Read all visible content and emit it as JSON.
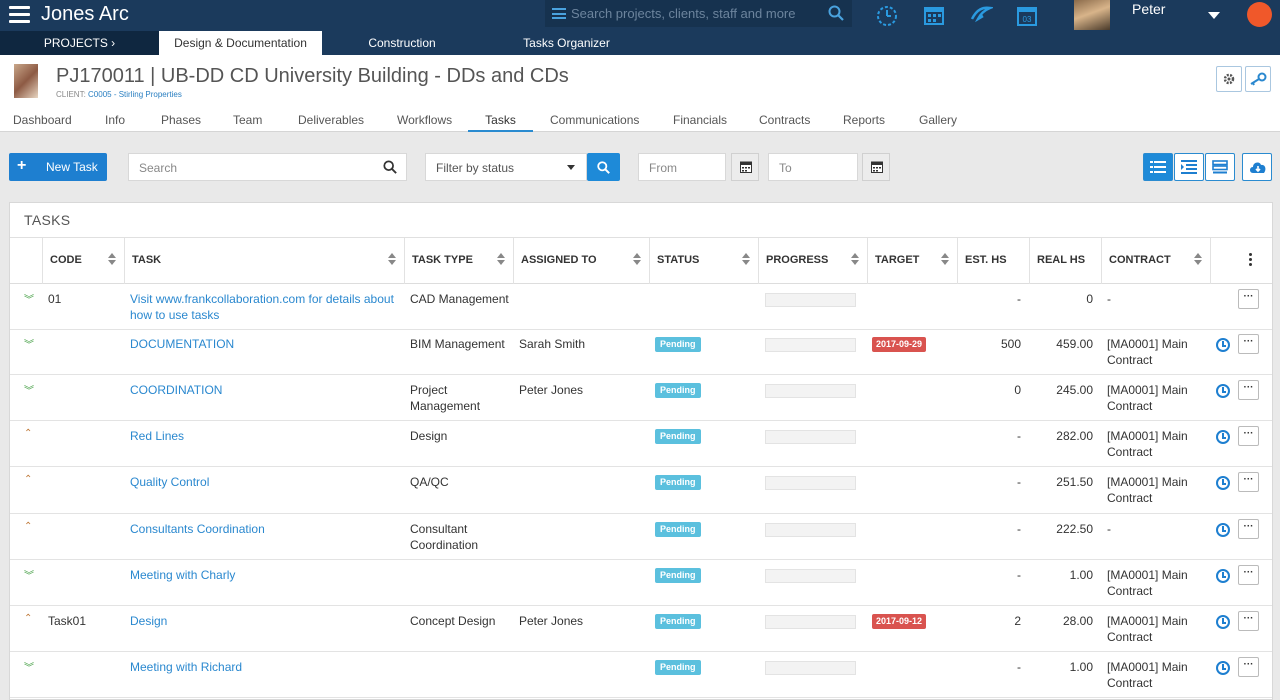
{
  "app": {
    "title": "Jones Arc",
    "search_placeholder": "Search projects, clients, staff and more",
    "user_name": "Peter"
  },
  "modules": [
    {
      "label": "PROJECTS ›",
      "active": false
    },
    {
      "label": "Design & Documentation",
      "active": true
    },
    {
      "label": "Construction",
      "active": false
    },
    {
      "label": "Tasks Organizer",
      "active": false
    }
  ],
  "project": {
    "title": "PJ170011 | UB-DD CD University Building - DDs and CDs",
    "client_label": "CLIENT:",
    "client_value": "C0005 - Stirling Properties"
  },
  "tabs": [
    "Dashboard",
    "Info",
    "Phases",
    "Team",
    "Deliverables",
    "Workflows",
    "Tasks",
    "Communications",
    "Financials",
    "Contracts",
    "Reports",
    "Gallery"
  ],
  "active_tab": "Tasks",
  "toolbar": {
    "new_task": "New Task",
    "search_placeholder": "Search",
    "filter_placeholder": "Filter by status",
    "from_placeholder": "From",
    "to_placeholder": "To"
  },
  "panel": {
    "title": "TASKS"
  },
  "columns": [
    "CODE",
    "TASK",
    "TASK TYPE",
    "ASSIGNED TO",
    "STATUS",
    "PROGRESS",
    "TARGET",
    "EST. HS",
    "REAL HS",
    "CONTRACT"
  ],
  "rows": [
    {
      "chevron": "down",
      "code": "01",
      "task_l1": "Visit www.frankcollaboration.com for details about",
      "task_l2": "how to use tasks",
      "type_l1": "CAD Management",
      "type_l2": "",
      "assigned": "",
      "status": "",
      "target": "",
      "est": "-",
      "real": "0",
      "contract_l1": "-",
      "contract_l2": "",
      "clock": false
    },
    {
      "chevron": "down",
      "code": "",
      "task_l1": "DOCUMENTATION",
      "task_l2": "",
      "type_l1": "BIM Management",
      "type_l2": "",
      "assigned": "Sarah Smith",
      "status": "Pending",
      "target": "2017-09-29",
      "est": "500",
      "real": "459.00",
      "contract_l1": "[MA0001] Main",
      "contract_l2": "Contract",
      "clock": true
    },
    {
      "chevron": "down",
      "code": "",
      "task_l1": "COORDINATION",
      "task_l2": "",
      "type_l1": "Project",
      "type_l2": "Management",
      "assigned": "Peter Jones",
      "status": "Pending",
      "target": "",
      "est": "0",
      "real": "245.00",
      "contract_l1": "[MA0001] Main",
      "contract_l2": "Contract",
      "clock": true
    },
    {
      "chevron": "up",
      "code": "",
      "task_l1": "Red Lines",
      "task_l2": "",
      "type_l1": "Design",
      "type_l2": "",
      "assigned": "",
      "status": "Pending",
      "target": "",
      "est": "-",
      "real": "282.00",
      "contract_l1": "[MA0001] Main",
      "contract_l2": "Contract",
      "clock": true
    },
    {
      "chevron": "up",
      "code": "",
      "task_l1": "Quality Control",
      "task_l2": "",
      "type_l1": "QA/QC",
      "type_l2": "",
      "assigned": "",
      "status": "Pending",
      "target": "",
      "est": "-",
      "real": "251.50",
      "contract_l1": "[MA0001] Main",
      "contract_l2": "Contract",
      "clock": true
    },
    {
      "chevron": "up",
      "code": "",
      "task_l1": "Consultants Coordination",
      "task_l2": "",
      "type_l1": "Consultant",
      "type_l2": "Coordination",
      "assigned": "",
      "status": "Pending",
      "target": "",
      "est": "-",
      "real": "222.50",
      "contract_l1": "-",
      "contract_l2": "",
      "clock": true
    },
    {
      "chevron": "down",
      "code": "",
      "task_l1": "Meeting with Charly",
      "task_l2": "",
      "type_l1": "",
      "type_l2": "",
      "assigned": "",
      "status": "Pending",
      "target": "",
      "est": "-",
      "real": "1.00",
      "contract_l1": "[MA0001] Main",
      "contract_l2": "Contract",
      "clock": true
    },
    {
      "chevron": "up",
      "code": "Task01",
      "task_l1": "Design",
      "task_l2": "",
      "type_l1": "Concept Design",
      "type_l2": "",
      "assigned": "Peter Jones",
      "status": "Pending",
      "target": "2017-09-12",
      "est": "2",
      "real": "28.00",
      "contract_l1": "[MA0001] Main",
      "contract_l2": "Contract",
      "clock": true
    },
    {
      "chevron": "down",
      "code": "",
      "task_l1": "Meeting with Richard",
      "task_l2": "",
      "type_l1": "",
      "type_l2": "",
      "assigned": "",
      "status": "Pending",
      "target": "",
      "est": "-",
      "real": "1.00",
      "contract_l1": "[MA0001] Main",
      "contract_l2": "Contract",
      "clock": true
    }
  ],
  "colors": {
    "navy": "#1b3a5c",
    "accent": "#1e7fd0",
    "pending": "#5bc0de",
    "overdue": "#d9534f"
  }
}
